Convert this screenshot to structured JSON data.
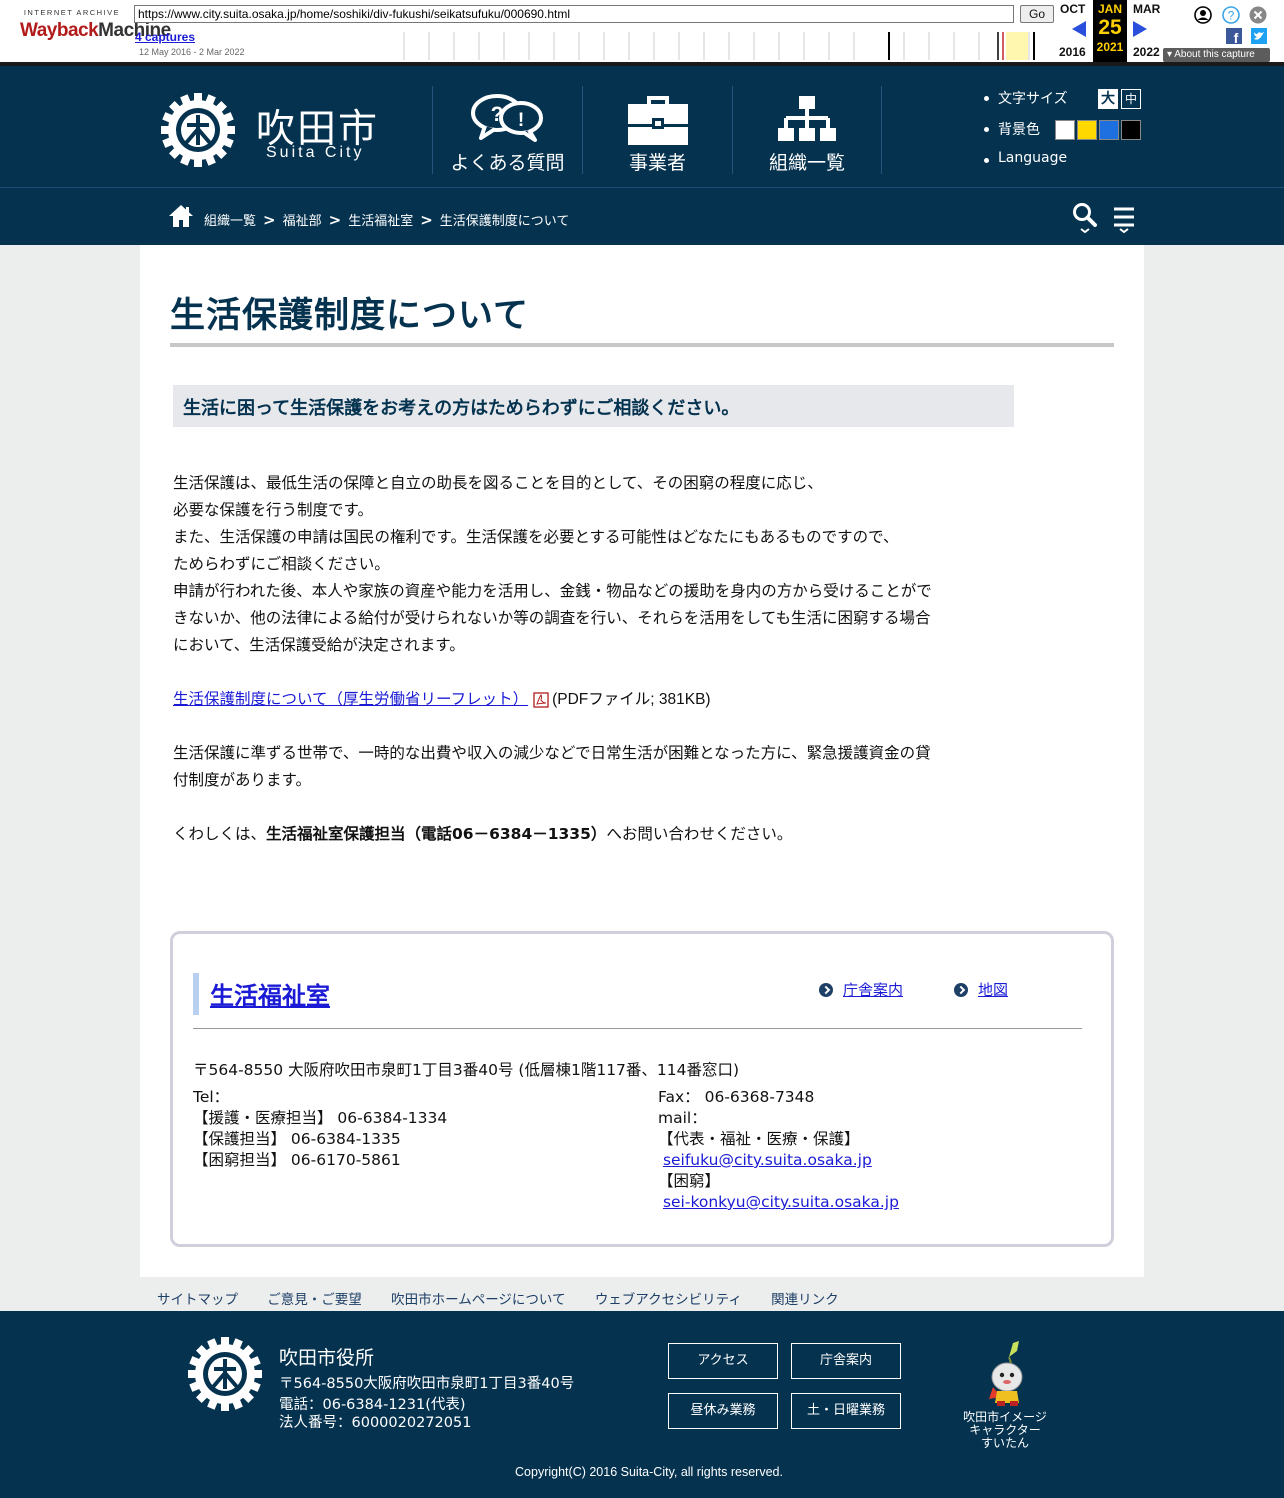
{
  "wayback": {
    "logo_top": "INTERNET ARCHIVE",
    "logo_main_a": "Wayback",
    "logo_main_b": "Machine",
    "url": "https://www.city.suita.osaka.jp/home/soshiki/div-fukushi/seikatsufuku/000690.html",
    "go_label": "Go",
    "captures": "4 captures",
    "range": "12 May 2016 - 2 Mar 2022",
    "prev_month": "OCT",
    "cur_month": "JAN",
    "next_month": "MAR",
    "cur_day": "25",
    "prev_year": "2016",
    "cur_year": "2021",
    "next_year": "2022",
    "about": "About this capture"
  },
  "header": {
    "city_name": "吹田市",
    "city_sub": "Suita City",
    "nav": [
      {
        "label": "よくある質問",
        "icon": "faq-bubbles-icon"
      },
      {
        "label": "事業者",
        "icon": "briefcase-icon"
      },
      {
        "label": "組織一覧",
        "icon": "org-chart-icon"
      }
    ],
    "tools": {
      "font_size_label": "文字サイズ",
      "font_large": "大",
      "font_medium": "中",
      "bg_color_label": "背景色",
      "bg_colors": [
        "#ffffff",
        "#ffd800",
        "#1e6fe0",
        "#000000"
      ],
      "language_label": "Language"
    }
  },
  "breadcrumb": {
    "items": [
      "組織一覧",
      "福祉部",
      "生活福祉室",
      "生活保護制度について"
    ],
    "sep": ">"
  },
  "content": {
    "title": "生活保護制度について",
    "subhead": "生活に困って生活保護をお考えの方はためらわずにご相談ください。",
    "para1": [
      "生活保護は、最低生活の保障と自立の助長を図ることを目的として、その困窮の程度に応じ、",
      "必要な保護を行う制度です。",
      "また、生活保護の申請は国民の権利です。生活保護を必要とする可能性はどなたにもあるものですので、",
      "ためらわずにご相談ください。",
      "申請が行われた後、本人や家族の資産や能力を活用し、金銭・物品などの援助を身内の方から受けることがで",
      "きないか、他の法律による給付が受けられないか等の調査を行い、それらを活用をしても生活に困窮する場合",
      "において、生活保護受給が決定されます。"
    ],
    "pdf_link": "生活保護制度について（厚生労働省リーフレット）",
    "pdf_info": "(PDFファイル; 381KB)",
    "para2": [
      "生活保護に準ずる世帯で、一時的な出費や収入の減少などで日常生活が困難となった方に、緊急援護資金の貸",
      "付制度があります。"
    ],
    "inquiry_pre": "くわしくは、",
    "inquiry_bold": "生活福祉室保護担当（電話06－6384－1335）",
    "inquiry_post": "へお問い合わせください。"
  },
  "contact": {
    "office": "生活福祉室",
    "link_building": "庁舎案内",
    "link_map": "地図",
    "address": "〒564-8550  大阪府吹田市泉町1丁目3番40号  (低層棟1階117番、114番窓口)",
    "tel_label": "Tel：",
    "tel_lines": [
      "【援護・医療担当】 06-6384-1334",
      "【保護担当】 06-6384-1335",
      "【困窮担当】 06-6170-5861"
    ],
    "fax": "Fax： 06-6368-7348",
    "mail_label": "mail：",
    "mail_group1": "【代表・福祉・医療・保護】",
    "mail1": "seifuku@city.suita.osaka.jp",
    "mail_group2": "【困窮】",
    "mail2": "sei-konkyu@city.suita.osaka.jp"
  },
  "footer_links": [
    "サイトマップ",
    "ご意見・ご要望",
    "吹田市ホームページについて",
    "ウェブアクセシビリティ",
    "関連リンク"
  ],
  "footer": {
    "name": "吹田市役所",
    "address": "〒564-8550大阪府吹田市泉町1丁目3番40号",
    "phone": "電話：06-6384-1231(代表)",
    "corp_no": "法人番号：6000020272051",
    "buttons": [
      "アクセス",
      "庁舎案内",
      "昼休み業務",
      "土・日曜業務"
    ],
    "mascot_caption": [
      "吹田市イメージ",
      "キャラクター",
      "すいたん"
    ],
    "copyright": "Copyright(C) 2016 Suita-City, all rights reserved."
  }
}
